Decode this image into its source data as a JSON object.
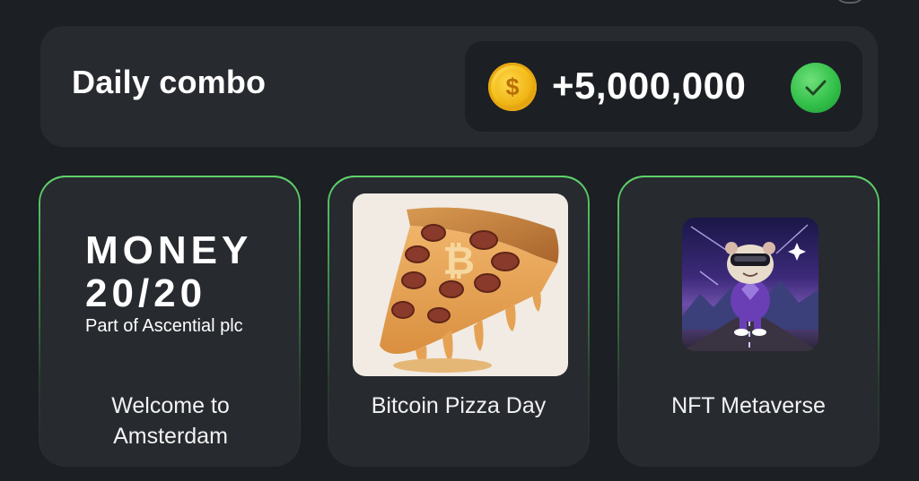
{
  "daily_combo": {
    "title": "Daily combo",
    "reward_amount": "+5,000,000",
    "coin_icon": "coin-icon",
    "status_icon": "check-icon",
    "status_color": "#33c04a",
    "coin_symbol": "$"
  },
  "cards": [
    {
      "logo_line1": "MONEY",
      "logo_line2": "20/20",
      "logo_line3": "Part of Ascential plc",
      "label": "Welcome to Amsterdam"
    },
    {
      "image": "pizza-image",
      "label": "Bitcoin Pizza Day"
    },
    {
      "image": "nft-hamster-image",
      "label": "NFT Metaverse"
    }
  ],
  "colors": {
    "background": "#1c1f24",
    "panel": "#272a2f",
    "card_border": "#5ed36b",
    "coin": "#f6c21b"
  }
}
